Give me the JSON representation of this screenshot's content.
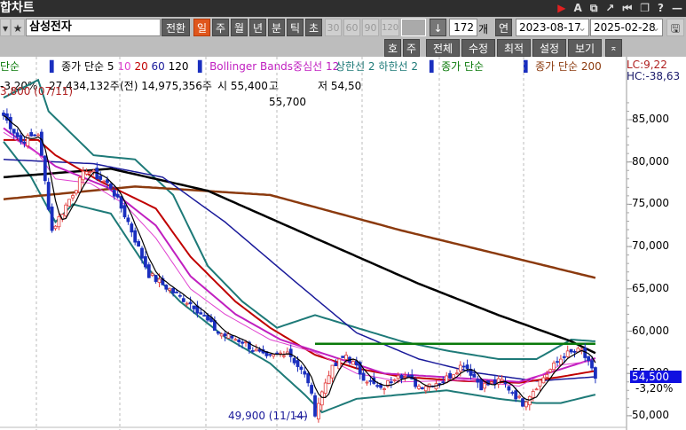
{
  "window": {
    "title": "합차트",
    "icons": [
      "play-icon",
      "font-icon",
      "new-window-icon",
      "popout-icon",
      "first-icon",
      "restore-icon",
      "help-icon",
      "minimize-icon"
    ]
  },
  "toolbar": {
    "stock_name": "삼성전자",
    "convert": "전환",
    "periods": [
      "일",
      "주",
      "월",
      "년",
      "분",
      "틱",
      "초"
    ],
    "active_period": "일",
    "minutes": [
      "30",
      "60",
      "90",
      "120"
    ],
    "count": "172",
    "count_unit": "개",
    "continuous": "연",
    "start_date": "2023-08-17",
    "end_date": "2025-02-28"
  },
  "info": {
    "change_pct": "-3,20%",
    "volume": "27,434,132주",
    "prev_volume": "(전) 14,975,356주",
    "open": "시 55,400",
    "high": "고 55,700",
    "low": "저 54,50"
  },
  "toolbar2": {
    "buttons": [
      "호",
      "주",
      "전체",
      "수정",
      "최적",
      "설정",
      "보기"
    ]
  },
  "legend": {
    "l0": "단순",
    "ma_label": "종가 단순 5",
    "ma10": "10",
    "ma20": "20",
    "ma60": "60",
    "ma120": "120",
    "bb": "Bollinger Bands중심선 12",
    "upper": "상한선 2",
    "lower": "하한선 2",
    "close_simple": "종가 단순",
    "ma200": "종가 단순 200",
    "lc": "LC:9,22",
    "hc": "HC:-38,63"
  },
  "colors": {
    "up": "#e23c3c",
    "down": "#1a2fbf",
    "ma5": "#000000",
    "ma10": "#e040d0",
    "ma20": "#c00000",
    "ma60": "#1a1a9a",
    "ma120": "#000000",
    "ma200": "#8b3a0e",
    "bb_mid": "#c020c0",
    "bb_band": "#1e7a78",
    "resistance": "#0a7a0a"
  },
  "chart_data": {
    "type": "candlestick",
    "bars": 172,
    "ylim": [
      49000,
      87000
    ],
    "y_ticks": [
      "85,000",
      "80,000",
      "75,000",
      "70,000",
      "65,000",
      "60,000",
      "55,000",
      "50,000"
    ],
    "y_tick_values": [
      85000,
      80000,
      75000,
      70000,
      65000,
      60000,
      55000,
      50000
    ],
    "high_annotation": "3,800 (07/11)",
    "low_annotation": "49,900 (11/14)",
    "low_value": 49900,
    "current_price": "54,500",
    "current_value": 54500,
    "current_change": "-3,20%",
    "resistance_level": 58500,
    "resistance_from": 90,
    "close": [
      [
        0,
        85500
      ],
      [
        5,
        82400
      ],
      [
        10,
        83400
      ],
      [
        14,
        71900
      ],
      [
        19,
        75600
      ],
      [
        24,
        79200
      ],
      [
        31,
        77100
      ],
      [
        36,
        72900
      ],
      [
        42,
        66700
      ],
      [
        49,
        64600
      ],
      [
        55,
        63000
      ],
      [
        62,
        59800
      ],
      [
        69,
        58800
      ],
      [
        76,
        56700
      ],
      [
        82,
        57700
      ],
      [
        88,
        54100
      ],
      [
        90,
        50400
      ],
      [
        94,
        55100
      ],
      [
        99,
        57200
      ],
      [
        104,
        54600
      ],
      [
        109,
        53000
      ],
      [
        114,
        55100
      ],
      [
        120,
        53500
      ],
      [
        127,
        54100
      ],
      [
        133,
        56200
      ],
      [
        138,
        53500
      ],
      [
        144,
        54100
      ],
      [
        150,
        51500
      ],
      [
        155,
        54100
      ],
      [
        162,
        57200
      ],
      [
        167,
        57700
      ],
      [
        171,
        54500
      ]
    ],
    "ma200": [
      [
        0,
        75600
      ],
      [
        38,
        77100
      ],
      [
        77,
        76100
      ],
      [
        115,
        71900
      ],
      [
        141,
        69300
      ],
      [
        171,
        66300
      ]
    ],
    "ma120": [
      [
        0,
        78200
      ],
      [
        31,
        79200
      ],
      [
        59,
        76600
      ],
      [
        85,
        71900
      ],
      [
        120,
        65600
      ],
      [
        143,
        61900
      ],
      [
        164,
        58800
      ],
      [
        171,
        57400
      ]
    ],
    "ma60": [
      [
        0,
        80300
      ],
      [
        26,
        79800
      ],
      [
        46,
        78200
      ],
      [
        64,
        72900
      ],
      [
        85,
        65600
      ],
      [
        102,
        59800
      ],
      [
        120,
        56700
      ],
      [
        136,
        55100
      ],
      [
        154,
        54100
      ],
      [
        171,
        54600
      ]
    ],
    "ma20": [
      [
        0,
        82600
      ],
      [
        10,
        82600
      ],
      [
        15,
        80800
      ],
      [
        28,
        77700
      ],
      [
        44,
        74500
      ],
      [
        54,
        68800
      ],
      [
        67,
        63500
      ],
      [
        77,
        60400
      ],
      [
        90,
        57200
      ],
      [
        102,
        55600
      ],
      [
        115,
        54600
      ],
      [
        133,
        54100
      ],
      [
        149,
        53900
      ],
      [
        161,
        54600
      ],
      [
        171,
        55300
      ]
    ],
    "ma10": [
      [
        0,
        83500
      ],
      [
        10,
        81000
      ],
      [
        15,
        78000
      ],
      [
        25,
        77500
      ],
      [
        35,
        75000
      ],
      [
        44,
        71000
      ],
      [
        54,
        65000
      ],
      [
        64,
        62000
      ],
      [
        77,
        59000
      ],
      [
        90,
        57500
      ],
      [
        102,
        55000
      ],
      [
        115,
        54000
      ],
      [
        133,
        54200
      ],
      [
        149,
        53500
      ],
      [
        161,
        56000
      ],
      [
        171,
        56500
      ]
    ],
    "bb_mid": [
      [
        0,
        84000
      ],
      [
        15,
        79500
      ],
      [
        30,
        77000
      ],
      [
        44,
        72500
      ],
      [
        54,
        66500
      ],
      [
        67,
        62000
      ],
      [
        80,
        59000
      ],
      [
        95,
        57000
      ],
      [
        110,
        55000
      ],
      [
        130,
        54500
      ],
      [
        149,
        54000
      ],
      [
        161,
        55500
      ],
      [
        171,
        56800
      ]
    ],
    "bb_upper": [
      [
        0,
        87600
      ],
      [
        10,
        89700
      ],
      [
        13,
        86000
      ],
      [
        26,
        80800
      ],
      [
        38,
        80300
      ],
      [
        49,
        76100
      ],
      [
        59,
        67700
      ],
      [
        69,
        63500
      ],
      [
        79,
        60400
      ],
      [
        90,
        61900
      ],
      [
        102,
        60400
      ],
      [
        115,
        58800
      ],
      [
        128,
        57700
      ],
      [
        143,
        56700
      ],
      [
        154,
        56700
      ],
      [
        164,
        59000
      ],
      [
        171,
        58800
      ]
    ],
    "bb_lower": [
      [
        0,
        82400
      ],
      [
        8,
        78200
      ],
      [
        15,
        72900
      ],
      [
        20,
        75000
      ],
      [
        31,
        73900
      ],
      [
        41,
        67700
      ],
      [
        51,
        63500
      ],
      [
        64,
        59300
      ],
      [
        77,
        56200
      ],
      [
        87,
        52500
      ],
      [
        92,
        50400
      ],
      [
        102,
        52000
      ],
      [
        115,
        52500
      ],
      [
        128,
        53000
      ],
      [
        143,
        52000
      ],
      [
        154,
        51500
      ],
      [
        161,
        51500
      ],
      [
        171,
        52500
      ]
    ]
  }
}
